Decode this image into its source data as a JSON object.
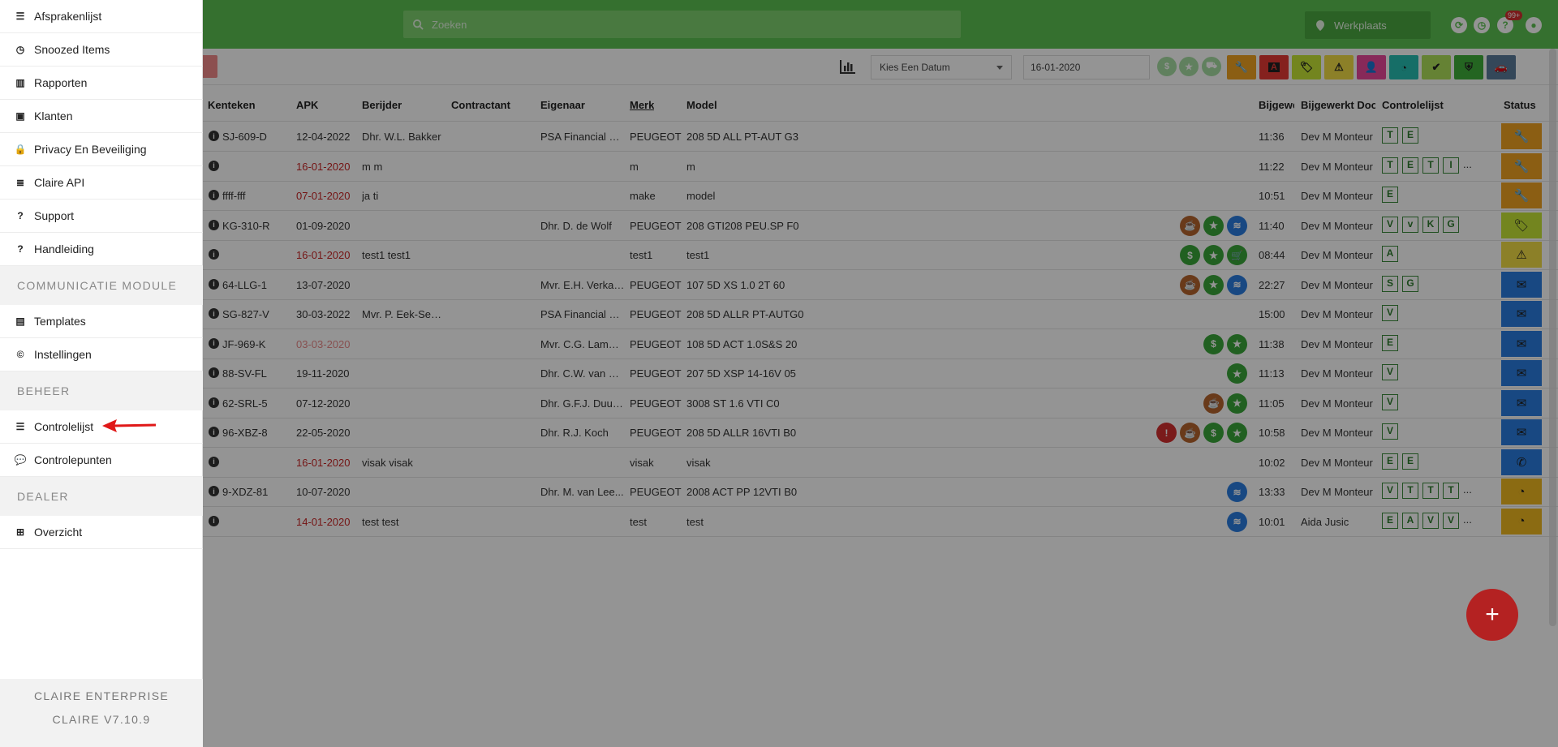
{
  "topbar": {
    "search_placeholder": "Zoeken",
    "workshop_label": "Werkplaats",
    "notification_badge": "99+"
  },
  "toolbar": {
    "date_select_label": "Kies Een Datum",
    "date_value": "16-01-2020",
    "color_buttons": [
      {
        "name": "wrench",
        "color": "#f0a321",
        "glyph": "🔧"
      },
      {
        "name": "letter-a",
        "color": "#e53935",
        "glyph": "A"
      },
      {
        "name": "tag",
        "color": "#c6e636",
        "glyph": "🏷"
      },
      {
        "name": "warning",
        "color": "#f2dc45",
        "glyph": "⚠"
      },
      {
        "name": "user-plus",
        "color": "#e8479a",
        "glyph": "👤"
      },
      {
        "name": "gauge",
        "color": "#26bdb1",
        "glyph": "◔"
      },
      {
        "name": "double-check",
        "color": "#aee05a",
        "glyph": "✔"
      },
      {
        "name": "shield",
        "color": "#3fae3a",
        "glyph": "⛨"
      },
      {
        "name": "car",
        "color": "#5a7a9a",
        "glyph": "🚗"
      }
    ]
  },
  "table": {
    "headers": [
      "Kenteken",
      "APK",
      "Berijder",
      "Contractant",
      "Eigenaar",
      "Merk",
      "Model",
      "Bijgewe",
      "Bijgewerkt Door",
      "Controlelijst",
      "Status"
    ],
    "rows": [
      {
        "kenteken": "SJ-609-D",
        "apk": "12-04-2022",
        "apk_style": "",
        "berijder": "Dhr. W.L. Bakker",
        "eigenaar": "PSA Financial Se...",
        "merk": "PEUGEOT",
        "model": "208 5D ALL PT-AUT G3",
        "icons": [],
        "tijd": "11:36",
        "door": "Dev M Monteur",
        "checks": [
          "T",
          "E"
        ],
        "status": {
          "color": "#f0a321",
          "glyph": "🔧"
        }
      },
      {
        "kenteken": "",
        "apk": "16-01-2020",
        "apk_style": "red",
        "berijder": "m m",
        "eigenaar": "",
        "merk": "m",
        "model": "m",
        "icons": [],
        "tijd": "11:22",
        "door": "Dev M Monteur",
        "checks": [
          "T",
          "E",
          "T",
          "I",
          "..."
        ],
        "status": {
          "color": "#f0a321",
          "glyph": "🔧"
        }
      },
      {
        "kenteken": "ffff-fff",
        "apk": "07-01-2020",
        "apk_style": "red",
        "berijder": "ja ti",
        "eigenaar": "",
        "merk": "make",
        "model": "model",
        "icons": [],
        "tijd": "10:51",
        "door": "Dev M Monteur",
        "checks": [
          "E"
        ],
        "status": {
          "color": "#f0a321",
          "glyph": "🔧"
        }
      },
      {
        "kenteken": "KG-310-R",
        "apk": "01-09-2020",
        "apk_style": "",
        "berijder": "",
        "eigenaar": "Dhr. D. de Wolf",
        "merk": "PEUGEOT",
        "model": "208 GTI208 PEU.SP F0",
        "icons": [
          "cup",
          "star",
          "wash"
        ],
        "tijd": "11:40",
        "door": "Dev M Monteur",
        "checks": [
          "V",
          "v",
          "K",
          "G"
        ],
        "status": {
          "color": "#c6e636",
          "glyph": "🏷"
        }
      },
      {
        "kenteken": "",
        "apk": "16-01-2020",
        "apk_style": "red",
        "berijder": "test1 test1",
        "eigenaar": "",
        "merk": "test1",
        "model": "test1",
        "icons": [
          "dollar",
          "star",
          "cart"
        ],
        "tijd": "08:44",
        "door": "Dev M Monteur",
        "checks": [
          "A"
        ],
        "status": {
          "color": "#f2dc45",
          "glyph": "⚠"
        }
      },
      {
        "kenteken": "64-LLG-1",
        "apk": "13-07-2020",
        "apk_style": "",
        "berijder": "",
        "eigenaar": "Mvr. E.H. Verkade",
        "merk": "PEUGEOT",
        "model": "107 5D XS 1.0 2T 60",
        "icons": [
          "cup",
          "star",
          "wash"
        ],
        "tijd": "22:27",
        "door": "Dev M Monteur",
        "checks": [
          "S",
          "G"
        ],
        "status": {
          "color": "#2a7de1",
          "glyph": "✉"
        }
      },
      {
        "kenteken": "SG-827-V",
        "apk": "30-03-2022",
        "apk_style": "",
        "berijder": "Mvr. P. Eek-Seeg...",
        "eigenaar": "PSA Financial Se...",
        "merk": "PEUGEOT",
        "model": "208 5D ALLR PT-AUTG0",
        "icons": [],
        "tijd": "15:00",
        "door": "Dev M Monteur",
        "checks": [
          "V"
        ],
        "status": {
          "color": "#2a7de1",
          "glyph": "✉"
        }
      },
      {
        "kenteken": "JF-969-K",
        "apk": "03-03-2020",
        "apk_style": "pink",
        "berijder": "",
        "eigenaar": "Mvr. C.G. Lamm...",
        "merk": "PEUGEOT",
        "model": "108 5D ACT 1.0S&S 20",
        "icons": [
          "dollar",
          "star"
        ],
        "tijd": "11:38",
        "door": "Dev M Monteur",
        "checks": [
          "E"
        ],
        "status": {
          "color": "#2a7de1",
          "glyph": "✉"
        }
      },
      {
        "kenteken": "88-SV-FL",
        "apk": "19-11-2020",
        "apk_style": "",
        "berijder": "",
        "eigenaar": "Dhr. C.W. van de...",
        "merk": "PEUGEOT",
        "model": "207 5D XSP 14-16V 05",
        "icons": [
          "star"
        ],
        "tijd": "11:13",
        "door": "Dev M Monteur",
        "checks": [
          "V"
        ],
        "status": {
          "color": "#2a7de1",
          "glyph": "✉"
        }
      },
      {
        "kenteken": "62-SRL-5",
        "apk": "07-12-2020",
        "apk_style": "",
        "berijder": "",
        "eigenaar": "Dhr. G.F.J. Duurs...",
        "merk": "PEUGEOT",
        "model": "3008 ST 1.6 VTI C0",
        "icons": [
          "cup",
          "star"
        ],
        "tijd": "11:05",
        "door": "Dev M Monteur",
        "checks": [
          "V"
        ],
        "status": {
          "color": "#2a7de1",
          "glyph": "✉"
        }
      },
      {
        "kenteken": "96-XBZ-8",
        "apk": "22-05-2020",
        "apk_style": "",
        "berijder": "",
        "eigenaar": "Dhr. R.J. Koch",
        "merk": "PEUGEOT",
        "model": "208 5D ALLR 16VTI B0",
        "icons": [
          "warning",
          "cup",
          "dollar",
          "star"
        ],
        "tijd": "10:58",
        "door": "Dev M Monteur",
        "checks": [
          "V"
        ],
        "status": {
          "color": "#2a7de1",
          "glyph": "✉"
        }
      },
      {
        "kenteken": "",
        "apk": "16-01-2020",
        "apk_style": "red",
        "berijder": "visak visak",
        "eigenaar": "",
        "merk": "visak",
        "model": "visak",
        "icons": [],
        "tijd": "10:02",
        "door": "Dev M Monteur",
        "checks": [
          "E",
          "E"
        ],
        "status": {
          "color": "#2a7de1",
          "glyph": "✆"
        }
      },
      {
        "kenteken": "9-XDZ-81",
        "apk": "10-07-2020",
        "apk_style": "",
        "berijder": "",
        "eigenaar": "Dhr. M. van Lee...",
        "merk": "PEUGEOT",
        "model": "2008 ACT PP 12VTI B0",
        "icons": [
          "wash"
        ],
        "tijd": "13:33",
        "door": "Dev M Monteur",
        "checks": [
          "V",
          "T",
          "T",
          "T",
          "..."
        ],
        "status": {
          "color": "#f0b820",
          "glyph": "◔"
        }
      },
      {
        "kenteken": "",
        "apk": "14-01-2020",
        "apk_style": "red",
        "berijder": "test test",
        "eigenaar": "",
        "merk": "test",
        "model": "test",
        "icons": [
          "wash"
        ],
        "tijd": "10:01",
        "door": "Aida Jusic",
        "checks": [
          "E",
          "A",
          "V",
          "V",
          "..."
        ],
        "status": {
          "color": "#f0b820",
          "glyph": "◔"
        }
      }
    ]
  },
  "icon_styles": {
    "cup": {
      "color": "#b5652e",
      "glyph": "☕"
    },
    "star": {
      "color": "#3aa63a",
      "glyph": "★"
    },
    "wash": {
      "color": "#2a7de1",
      "glyph": "≋"
    },
    "dollar": {
      "color": "#3aa63a",
      "glyph": "$"
    },
    "cart": {
      "color": "#3aa63a",
      "glyph": "🛒"
    },
    "warning": {
      "color": "#d32f2f",
      "glyph": "!"
    }
  },
  "sidebar": {
    "items_top": [
      {
        "label": "Afsprakenlijst",
        "icon": "list-icon",
        "glyph": "☰"
      },
      {
        "label": "Snoozed Items",
        "icon": "clock-icon",
        "glyph": "◷"
      },
      {
        "label": "Rapporten",
        "icon": "bar-chart-icon",
        "glyph": "▥"
      },
      {
        "label": "Klanten",
        "icon": "id-card-icon",
        "glyph": "▣"
      },
      {
        "label": "Privacy En Beveiliging",
        "icon": "lock-icon",
        "glyph": "🔒"
      },
      {
        "label": "Claire API",
        "icon": "server-icon",
        "glyph": "≣"
      },
      {
        "label": "Support",
        "icon": "question-circle-icon",
        "glyph": "?"
      },
      {
        "label": "Handleiding",
        "icon": "question-icon",
        "glyph": "?"
      }
    ],
    "section_communicatie": "COMMUNICATIE MODULE",
    "items_communicatie": [
      {
        "label": "Templates",
        "icon": "film-icon",
        "glyph": "▤"
      },
      {
        "label": "Instellingen",
        "icon": "copyright-icon",
        "glyph": "©"
      }
    ],
    "section_beheer": "BEHEER",
    "items_beheer": [
      {
        "label": "Controlelijst",
        "icon": "list-ul-icon",
        "glyph": "☰"
      },
      {
        "label": "Controlepunten",
        "icon": "comment-icon",
        "glyph": "💬"
      }
    ],
    "section_dealer": "DEALER",
    "items_dealer": [
      {
        "label": "Overzicht",
        "icon": "sitemap-icon",
        "glyph": "⊞"
      }
    ],
    "footer_line1": "CLAIRE ENTERPRISE",
    "footer_line2": "CLAIRE V7.10.9"
  }
}
